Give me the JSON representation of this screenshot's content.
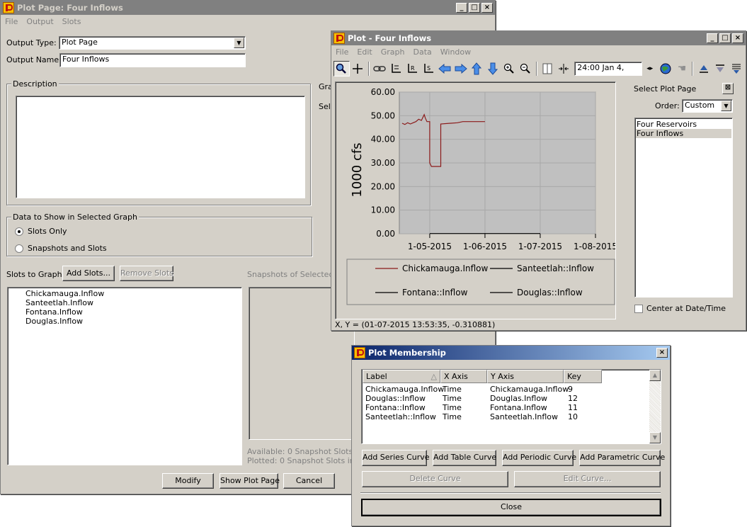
{
  "plot_page_window": {
    "title": "Plot Page: Four Inflows",
    "menu": [
      "File",
      "Output",
      "Slots"
    ],
    "output_type_label": "Output Type:",
    "output_type_value": "Plot Page",
    "output_name_label": "Output Name:",
    "output_name_value": "Four Inflows",
    "description_label": "Description",
    "graph_label_partial": "Gra",
    "select_label_partial": "Sel",
    "data_group_label": "Data to Show in Selected Graph",
    "radio_slots_only": "Slots Only",
    "radio_snapshots": "Snapshots and Slots",
    "slots_to_graph_label": "Slots to Graph:",
    "add_slots_button": "Add Slots...",
    "remove_slots_button": "Remove Slots",
    "snapshots_label": "Snapshots of Selected S",
    "slots": [
      "Chickamauga.Inflow",
      "Santeetlah.Inflow",
      "Fontana.Inflow",
      "Douglas.Inflow"
    ],
    "available_text": "Available:  0 Snapshot Slots in",
    "plotted_text": "Plotted:  0 Snapshot Slots in 0",
    "modify_button": "Modify",
    "show_plot_page_button": "Show Plot Page",
    "cancel_button": "Cancel"
  },
  "plot_window": {
    "title": "Plot - Four Inflows",
    "menu": [
      "File",
      "Edit",
      "Graph",
      "Data",
      "Window"
    ],
    "date_field": "24:00 Jan 4,",
    "select_plot_page_label": "Select Plot Page",
    "order_label": "Order:",
    "order_value": "Custom",
    "plot_pages": [
      "Four Reservoirs",
      "Four Inflows"
    ],
    "center_label": "Center at Date/Time",
    "status_text": "X, Y = (01-07-2015 13:53:35, -0.310881)"
  },
  "chart_data": {
    "type": "line",
    "ylabel": "1000 cfs",
    "y_ticks": [
      "60.00",
      "50.00",
      "40.00",
      "30.00",
      "20.00",
      "10.00",
      "0.00"
    ],
    "x_ticks": [
      "1-05-2015",
      "1-06-2015",
      "1-07-2015",
      "1-08-2015"
    ],
    "ylim": [
      0,
      60
    ],
    "grid": true,
    "legend_placement": "bottom",
    "series": [
      {
        "name": "Chickamauga.Inflow",
        "color": "#8b1a1a",
        "x": [
          4.5,
          4.55,
          4.6,
          4.65,
          4.7,
          4.75,
          4.8,
          4.85,
          4.9,
          4.92,
          4.95,
          5.0,
          5.0,
          5.03,
          5.2,
          5.2,
          5.5,
          5.6,
          6.0
        ],
        "y": [
          46.8,
          46.3,
          47.0,
          46.5,
          47.0,
          47.5,
          48.5,
          48.0,
          50.5,
          49.0,
          47.5,
          47.5,
          30.0,
          28.5,
          28.5,
          46.5,
          47.0,
          47.5,
          47.5
        ]
      },
      {
        "name": "Santeetlah::Inflow",
        "color": "#000000",
        "x": [],
        "y": []
      },
      {
        "name": "Fontana::Inflow",
        "color": "#000000",
        "x": [
          5.0,
          7.0
        ],
        "y": [
          0.1,
          0.1
        ]
      },
      {
        "name": "Douglas::Inflow",
        "color": "#000000",
        "x": [],
        "y": []
      }
    ]
  },
  "membership_window": {
    "title": "Plot Membership",
    "columns": [
      "Label",
      "X Axis",
      "Y Axis",
      "Key"
    ],
    "rows": [
      [
        "Chickamauga.Inflow",
        "Time",
        "Chickamauga.Inflow",
        "9"
      ],
      [
        "Douglas::Inflow",
        "Time",
        "Douglas.Inflow",
        "12"
      ],
      [
        "Fontana::Inflow",
        "Time",
        "Fontana.Inflow",
        "11"
      ],
      [
        "Santeetlah::Inflow",
        "Time",
        "Santeetlah.Inflow",
        "10"
      ]
    ],
    "add_series_button": "Add Series Curve",
    "add_table_button": "Add Table Curve",
    "add_periodic_button": "Add Periodic Curve",
    "add_parametric_button": "Add Parametric Curve",
    "delete_button": "Delete Curve",
    "edit_button": "Edit Curve...",
    "close_button": "Close"
  }
}
